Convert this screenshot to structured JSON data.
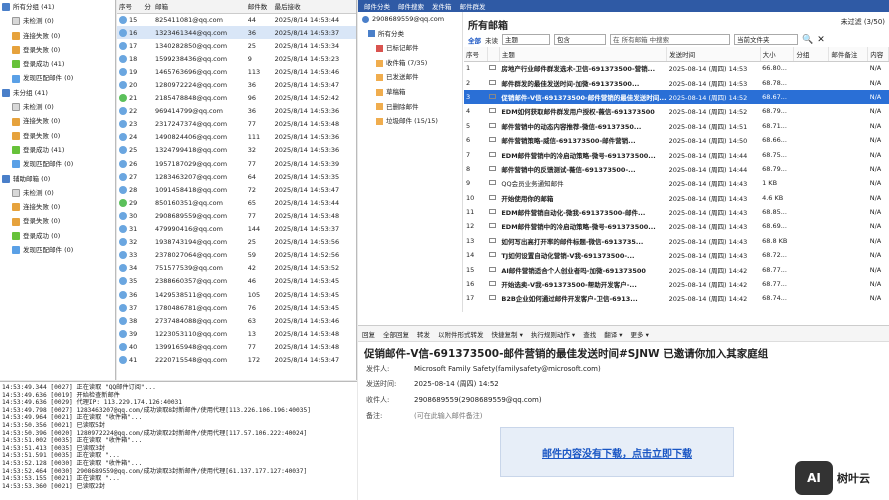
{
  "tree": [
    {
      "label": "所有分组 (41)",
      "level": 0,
      "icon": "folder-icon"
    },
    {
      "label": "未检测 (0)",
      "level": 1,
      "icon": "blank-icon"
    },
    {
      "label": "连接失败 (0)",
      "level": 1,
      "icon": "fail-icon"
    },
    {
      "label": "登录失败 (0)",
      "level": 1,
      "icon": "fail-icon"
    },
    {
      "label": "登录成功 (41)",
      "level": 1,
      "icon": "ok-icon"
    },
    {
      "label": "发现匹配邮件 (0)",
      "level": 1,
      "icon": "mail-icon"
    },
    {
      "label": "未分组 (41)",
      "level": 0,
      "icon": "folder-icon"
    },
    {
      "label": "未检测 (0)",
      "level": 1,
      "icon": "blank-icon"
    },
    {
      "label": "连接失败 (0)",
      "level": 1,
      "icon": "fail-icon"
    },
    {
      "label": "登录失败 (0)",
      "level": 1,
      "icon": "fail-icon"
    },
    {
      "label": "登录成功 (41)",
      "level": 1,
      "icon": "ok-icon"
    },
    {
      "label": "发现匹配邮件 (0)",
      "level": 1,
      "icon": "mail-icon"
    },
    {
      "label": "辅助邮箱 (0)",
      "level": 0,
      "icon": "folder-icon"
    },
    {
      "label": "未检测 (0)",
      "level": 1,
      "icon": "blank-icon"
    },
    {
      "label": "连接失败 (0)",
      "level": 1,
      "icon": "fail-icon"
    },
    {
      "label": "登录失败 (0)",
      "level": 1,
      "icon": "fail-icon"
    },
    {
      "label": "登录成功 (0)",
      "level": 1,
      "icon": "ok-icon"
    },
    {
      "label": "发现匹配邮件 (0)",
      "level": 1,
      "icon": "mail-icon"
    }
  ],
  "acct_headers": [
    "序号",
    "分",
    "邮箱",
    "邮件数",
    "最后接收"
  ],
  "accounts": [
    [
      "15",
      "",
      "825411081@qq.com",
      "44",
      "2025/8/14 14:53:44"
    ],
    [
      "16",
      "",
      "1323461344@qq.com",
      "36",
      "2025/8/14 14:53:37"
    ],
    [
      "17",
      "",
      "1340282850@qq.com",
      "25",
      "2025/8/14 14:53:34"
    ],
    [
      "18",
      "",
      "1599238436@qq.com",
      "9",
      "2025/8/14 14:53:23"
    ],
    [
      "19",
      "",
      "1465763696@qq.com",
      "113",
      "2025/8/14 14:53:46"
    ],
    [
      "20",
      "",
      "1280972224@qq.com",
      "36",
      "2025/8/14 14:53:47"
    ],
    [
      "21",
      "",
      "2185478848@qq.com",
      "96",
      "2025/8/14 14:52:42"
    ],
    [
      "22",
      "",
      "969414799@qq.com",
      "36",
      "2025/8/14 14:53:36"
    ],
    [
      "23",
      "",
      "2317247374@qq.com",
      "77",
      "2025/8/14 14:53:48"
    ],
    [
      "24",
      "",
      "1490824406@qq.com",
      "111",
      "2025/8/14 14:53:36"
    ],
    [
      "25",
      "",
      "1324799418@qq.com",
      "32",
      "2025/8/14 14:53:36"
    ],
    [
      "26",
      "",
      "1957187029@qq.com",
      "77",
      "2025/8/14 14:53:39"
    ],
    [
      "27",
      "",
      "1283463207@qq.com",
      "64",
      "2025/8/14 14:53:35"
    ],
    [
      "28",
      "",
      "1091458418@qq.com",
      "72",
      "2025/8/14 14:53:47"
    ],
    [
      "29",
      "",
      "850160351@qq.com",
      "65",
      "2025/8/14 14:53:44"
    ],
    [
      "30",
      "",
      "2908689559@qq.com",
      "77",
      "2025/8/14 14:53:48"
    ],
    [
      "31",
      "",
      "479990416@qq.com",
      "144",
      "2025/8/14 14:53:37"
    ],
    [
      "32",
      "",
      "1938743194@qq.com",
      "25",
      "2025/8/14 14:53:56"
    ],
    [
      "33",
      "",
      "2378027064@qq.com",
      "59",
      "2025/8/14 14:52:56"
    ],
    [
      "34",
      "",
      "751577539@qq.com",
      "42",
      "2025/8/14 14:53:52"
    ],
    [
      "35",
      "",
      "2388660357@qq.com",
      "46",
      "2025/8/14 14:53:45"
    ],
    [
      "36",
      "",
      "1429538511@qq.com",
      "105",
      "2025/8/14 14:53:45"
    ],
    [
      "37",
      "",
      "1780486781@qq.com",
      "76",
      "2025/8/14 14:53:45"
    ],
    [
      "38",
      "",
      "2737484088@qq.com",
      "63",
      "2025/8/14 14:53:46"
    ],
    [
      "39",
      "",
      "1223053110@qq.com",
      "13",
      "2025/8/14 14:53:48"
    ],
    [
      "40",
      "",
      "1399165948@qq.com",
      "77",
      "2025/8/14 14:53:48"
    ],
    [
      "41",
      "",
      "2220715548@qq.com",
      "172",
      "2025/8/14 14:53:47"
    ]
  ],
  "log": [
    "14:53:49.344 [0027] 正在读取 \"QQ邮件订阅\"...",
    "14:53:49.636 [0019] 开始检查新邮件",
    "14:53:49.636 [0029] 代理IP: 113.229.174.126:40031",
    "14:53:49.798 [0027] 1283463207@qq.com/成功读取8封新邮件/使用代理[113.226.106.196:40035]",
    "14:53:49.964 [0021] 正在读取 \"收件箱\"...",
    "14:53:50.356 [0021] 已读取5封",
    "14:53:50.396 [0020] 1280972224@qq.com/成功读取2封新邮件/使用代理[117.57.106.222:40024]",
    "14:53:51.002 [0035] 正在读取 \"收件箱\"...",
    "14:53:51.413 [0035] 已读取3封",
    "14:53:51.591 [0035] 正在读取 \"...",
    "14:53:52.128 [0030] 正在读取 \"收件箱\"...",
    "14:53:52.464 [0030] 2908689559@qq.com/成功读取3封新邮件/使用代理[61.137.177.127:40037]",
    "14:53:53.155 [0021] 正在读取 \"...",
    "14:53:53.360 [0021] 已读取2封"
  ],
  "menubar": [
    "邮件分类",
    "邮件搜索",
    "发件箱",
    "邮件群发"
  ],
  "account_email": "2908689559@qq.com",
  "folders": [
    {
      "label": "所有分类",
      "color": "#4a7fc9"
    },
    {
      "label": "已标记邮件",
      "color": "#d9534f"
    },
    {
      "label": "收件箱 (7/35)",
      "color": "#f0ad4e"
    },
    {
      "label": "已发送邮件",
      "color": "#f0ad4e"
    },
    {
      "label": "草稿箱",
      "color": "#f0ad4e"
    },
    {
      "label": "已删除邮件",
      "color": "#f0ad4e"
    },
    {
      "label": "垃圾邮件 (15/15)",
      "color": "#f0ad4e"
    }
  ],
  "list_title": "所有邮箱",
  "list_status": "未过滤 (3/50)",
  "filter": {
    "all": "全部",
    "unread": "未读",
    "field": "主题",
    "op": "包含",
    "scope": "在 所有邮箱 中搜索",
    "folder": "当前文件夹"
  },
  "mail_headers": [
    "序号",
    "",
    "主题",
    "发送时间",
    "大小",
    "分组",
    "邮件备注",
    "内容"
  ],
  "mails": [
    [
      "1",
      "",
      "房地产行业邮件群发选术-卫信-691373500-营销...",
      "2025-08-14 (周四) 14:53",
      "66.80...",
      "",
      "",
      "N/A"
    ],
    [
      "2",
      "",
      "邮件群发的最佳发送时间-加微-691373500...",
      "2025-08-14 (周四) 14:53",
      "68.78...",
      "",
      "",
      "N/A"
    ],
    [
      "3",
      "",
      "促销邮件-V信-691373500-邮件营销的最佳发送时间...",
      "2025-08-14 (周四) 14:52",
      "68.67...",
      "",
      "",
      "N/A"
    ],
    [
      "4",
      "",
      "EDM如何获取邮件群发用户授权-薇信-691373500",
      "2025-08-14 (周四) 14:52",
      "68.79...",
      "",
      "",
      "N/A"
    ],
    [
      "5",
      "",
      "邮件营销中的动态内容推荐-微信-69137350...",
      "2025-08-14 (周四) 14:51",
      "68.71...",
      "",
      "",
      "N/A"
    ],
    [
      "6",
      "",
      "邮件营销策略-威信-691373500-邮件营销...",
      "2025-08-14 (周四) 14:50",
      "68.66...",
      "",
      "",
      "N/A"
    ],
    [
      "7",
      "",
      "EDM邮件营销中的冷启动策略-微号-691373500...",
      "2025-08-14 (周四) 14:44",
      "68.75...",
      "",
      "",
      "N/A"
    ],
    [
      "8",
      "",
      "邮件营销中的反馈测试-薇信-691373500-...",
      "2025-08-14 (周四) 14:44",
      "68.79...",
      "",
      "",
      "N/A"
    ],
    [
      "9",
      "",
      "QQ会员业务通知邮件",
      "2025-08-14 (周四) 14:43",
      "1 KB",
      "",
      "",
      "N/A"
    ],
    [
      "10",
      "",
      "开始使用你的邮箱",
      "2025-08-14 (周四) 14:43",
      "4.6 KB",
      "",
      "",
      "N/A"
    ],
    [
      "11",
      "",
      "EDM邮件营销自动化-微我-691373500-邮件...",
      "2025-08-14 (周四) 14:43",
      "68.85...",
      "",
      "",
      "N/A"
    ],
    [
      "12",
      "",
      "EDM邮件营销中的冷启动策略-微号-691373500...",
      "2025-08-14 (周四) 14:43",
      "68.69...",
      "",
      "",
      "N/A"
    ],
    [
      "13",
      "",
      "如何写出高打开率的邮件标题-微信-6913735...",
      "2025-08-14 (周四) 14:43",
      "68.8 KB",
      "",
      "",
      "N/A"
    ],
    [
      "14",
      "",
      "TJ如何设置自动化营销-V我-691373500-...",
      "2025-08-14 (周四) 14:43",
      "68.72...",
      "",
      "",
      "N/A"
    ],
    [
      "15",
      "",
      "AI邮件营销适合个人创业者吗-加微-691373500",
      "2025-08-14 (周四) 14:42",
      "68.77...",
      "",
      "",
      "N/A"
    ],
    [
      "16",
      "",
      "开始选卖-V我-691373500-帮助开发客户-...",
      "2025-08-14 (周四) 14:42",
      "68.77...",
      "",
      "",
      "N/A"
    ],
    [
      "17",
      "",
      "B2B企业如何通过邮件开发客户-卫信-6913...",
      "2025-08-14 (周四) 14:42",
      "68.74...",
      "",
      "",
      "N/A"
    ]
  ],
  "toolbar2": [
    "回复",
    "全部回复",
    "转发",
    "以附件形式转发",
    "快捷复制 ▾",
    "执行规则动作 ▾",
    "查找",
    "翻译 ▾",
    "更多 ▾"
  ],
  "preview": {
    "subject": "促销邮件-V信-691373500-邮件营销的最佳发送时间#SJNW 已邀请你加入其家庭组",
    "rows": [
      {
        "k": "发件人:",
        "v": "Microsoft Family Safety(familysafety@microsoft.com)"
      },
      {
        "k": "发送时间:",
        "v": "2025-08-14 (周四) 14:52"
      },
      {
        "k": "收件人:",
        "v": "2908689559(2908689559@qq.com)"
      },
      {
        "k": "备注:",
        "v": "(可在此输入邮件备注)"
      }
    ],
    "download": "邮件内容没有下载，点击立即下载"
  },
  "watermark": {
    "logo": "AI",
    "text": "树叶云"
  }
}
